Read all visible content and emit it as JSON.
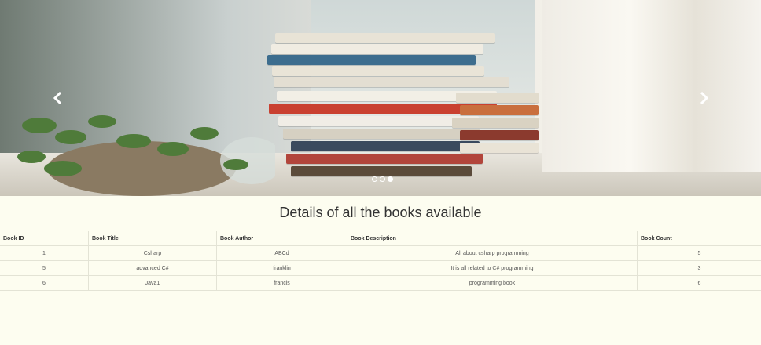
{
  "carousel": {
    "prev_icon": "chevron-left-icon",
    "next_icon": "chevron-right-icon",
    "indicators": [
      false,
      false,
      true
    ]
  },
  "page": {
    "title": "Details of all the books available"
  },
  "table": {
    "headers": [
      "Book ID",
      "Book Title",
      "Book Author",
      "Book Description",
      "Book Count"
    ],
    "rows": [
      [
        "1",
        "Csharp",
        "ABCd",
        "All about csharp programming",
        "5"
      ],
      [
        "5",
        "advanced C#",
        "franklin",
        "It is all related to C# programming",
        "3"
      ],
      [
        "6",
        "Java1",
        "francis",
        "programming book",
        "6"
      ]
    ]
  }
}
